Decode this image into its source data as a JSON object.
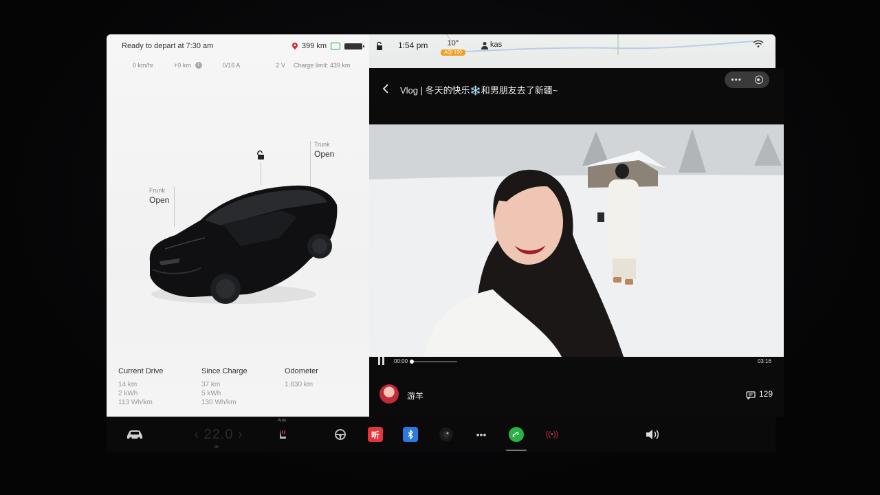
{
  "status": {
    "ready_text": "Ready to depart at 7:30 am",
    "range": "399 km"
  },
  "stats": {
    "speed": "0 km/hr",
    "added": "+0 km",
    "current": "0/16 A",
    "voltage": "2 V",
    "charge_limit": "Charge limit: 439 km"
  },
  "car": {
    "frunk_label": "Frunk",
    "frunk_value": "Open",
    "trunk_label": "Trunk",
    "trunk_value": "Open"
  },
  "trips": [
    {
      "title": "Current Drive",
      "distance": "14 km",
      "energy": "2 kWh",
      "efficiency": "113 Wh/km"
    },
    {
      "title": "Since Charge",
      "distance": "37 km",
      "energy": "5 kWh",
      "efficiency": "130 Wh/km"
    },
    {
      "title": "Odometer",
      "distance": "1,830 km",
      "energy": "",
      "efficiency": ""
    }
  ],
  "top_bar": {
    "time": "1:54 pm",
    "temperature": "10°",
    "aqi": "AQI 130",
    "user": "kas"
  },
  "video": {
    "title": "Vlog | 冬天的快乐❄️和男朋友去了新疆~",
    "current_time": "00:00",
    "total_time": "03:16",
    "progress": 0.0,
    "author": "游羊",
    "comment_count": "129"
  },
  "dock": {
    "ting_label": "听",
    "auto_label": "Auto"
  },
  "colors": {
    "panel_bg": "#f3f3f3",
    "app_bg": "#0b0b0c",
    "aqi": "#f0a01e",
    "ting": "#e3353a",
    "bluetooth": "#2a7ae2",
    "wechat": "#2ab24a",
    "radio": "#e0344d"
  }
}
